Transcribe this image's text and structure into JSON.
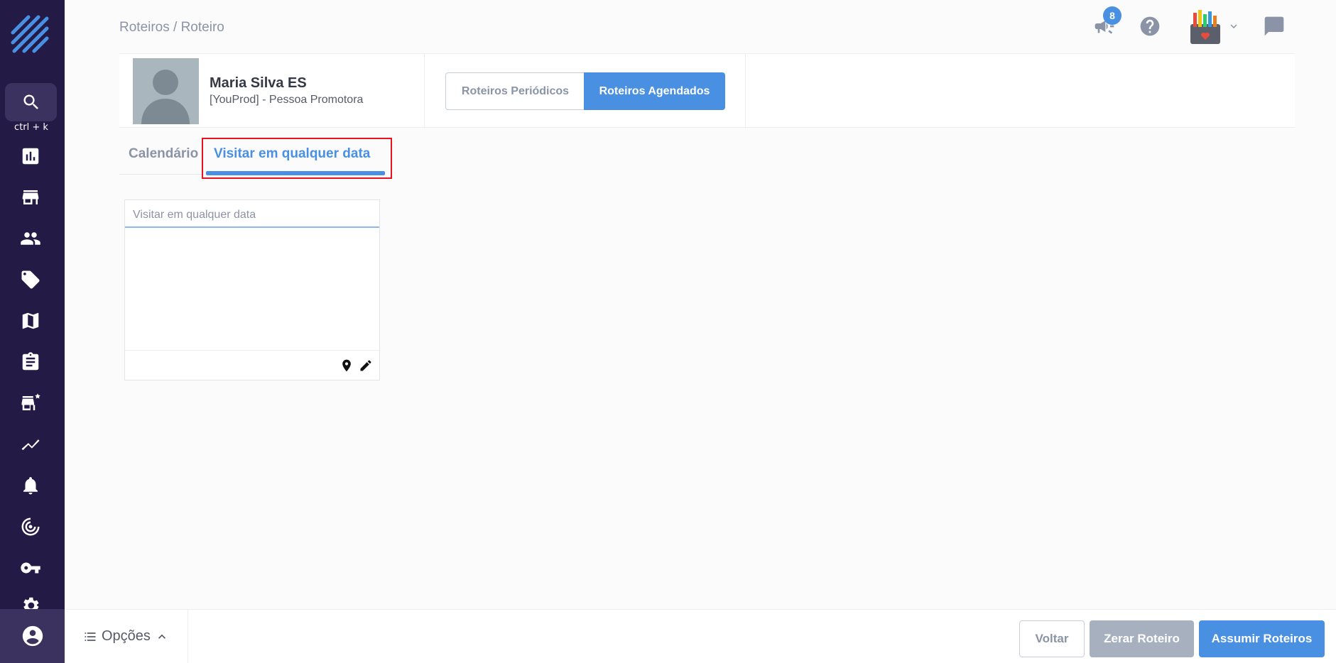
{
  "sidebar": {
    "search_hint": "ctrl + k",
    "icons": [
      "dashboard-icon",
      "store-icon",
      "people-icon",
      "tag-icon",
      "map-icon",
      "clipboard-icon",
      "store-star-icon",
      "trend-icon",
      "bell-icon",
      "radar-icon",
      "key-icon",
      "gear-icon"
    ],
    "bottom_icon": "account-circle-icon"
  },
  "header": {
    "breadcrumb": "Roteiros / Roteiro",
    "notification_count": "8"
  },
  "profile": {
    "name": "Maria Silva ES",
    "role": "[YouProd] - Pessoa Promotora"
  },
  "route_toggle": {
    "periodic": "Roteiros Periódicos",
    "scheduled": "Roteiros Agendados",
    "selected": "scheduled"
  },
  "tabs": [
    {
      "label": "Calendário",
      "active": false
    },
    {
      "label": "Visitar em qualquer data",
      "active": true
    }
  ],
  "visit_card": {
    "title": "Visitar em qualquer data"
  },
  "footer": {
    "options_label": "Opções",
    "back": "Voltar",
    "reset": "Zerar Roteiro",
    "assume": "Assumir Roteiros"
  },
  "colors": {
    "sidebar": "#231a45",
    "accent": "#4a90e2",
    "highlight": "#e8131f"
  }
}
